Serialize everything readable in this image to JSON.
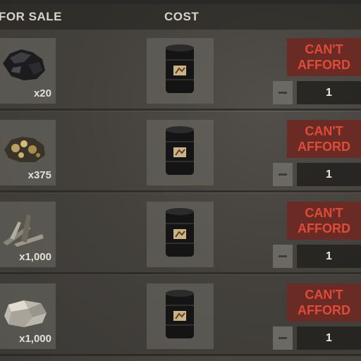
{
  "header": {
    "for_sale_label": "FOR SALE",
    "cost_label": "COST"
  },
  "colors": {
    "cant_afford_bg": "#6a2b24",
    "cant_afford_text": "#e04a38"
  },
  "rows": [
    {
      "item_icon": "coal-icon",
      "item_qty": "x20",
      "cost_icon": "oil-barrel-icon",
      "afford_line1": "CAN'T",
      "afford_line2": "AFFORD",
      "quantity": "1"
    },
    {
      "item_icon": "metal-ore-icon",
      "item_qty": "x375",
      "cost_icon": "oil-barrel-icon",
      "afford_line1": "CAN'T",
      "afford_line2": "AFFORD",
      "quantity": "1"
    },
    {
      "item_icon": "wood-icon",
      "item_qty": "x1,000",
      "cost_icon": "oil-barrel-icon",
      "afford_line1": "CAN'T",
      "afford_line2": "AFFORD",
      "quantity": "1"
    },
    {
      "item_icon": "stone-icon",
      "item_qty": "x1,000",
      "cost_icon": "oil-barrel-icon",
      "afford_line1": "CAN'T",
      "afford_line2": "AFFORD",
      "quantity": "1"
    }
  ]
}
